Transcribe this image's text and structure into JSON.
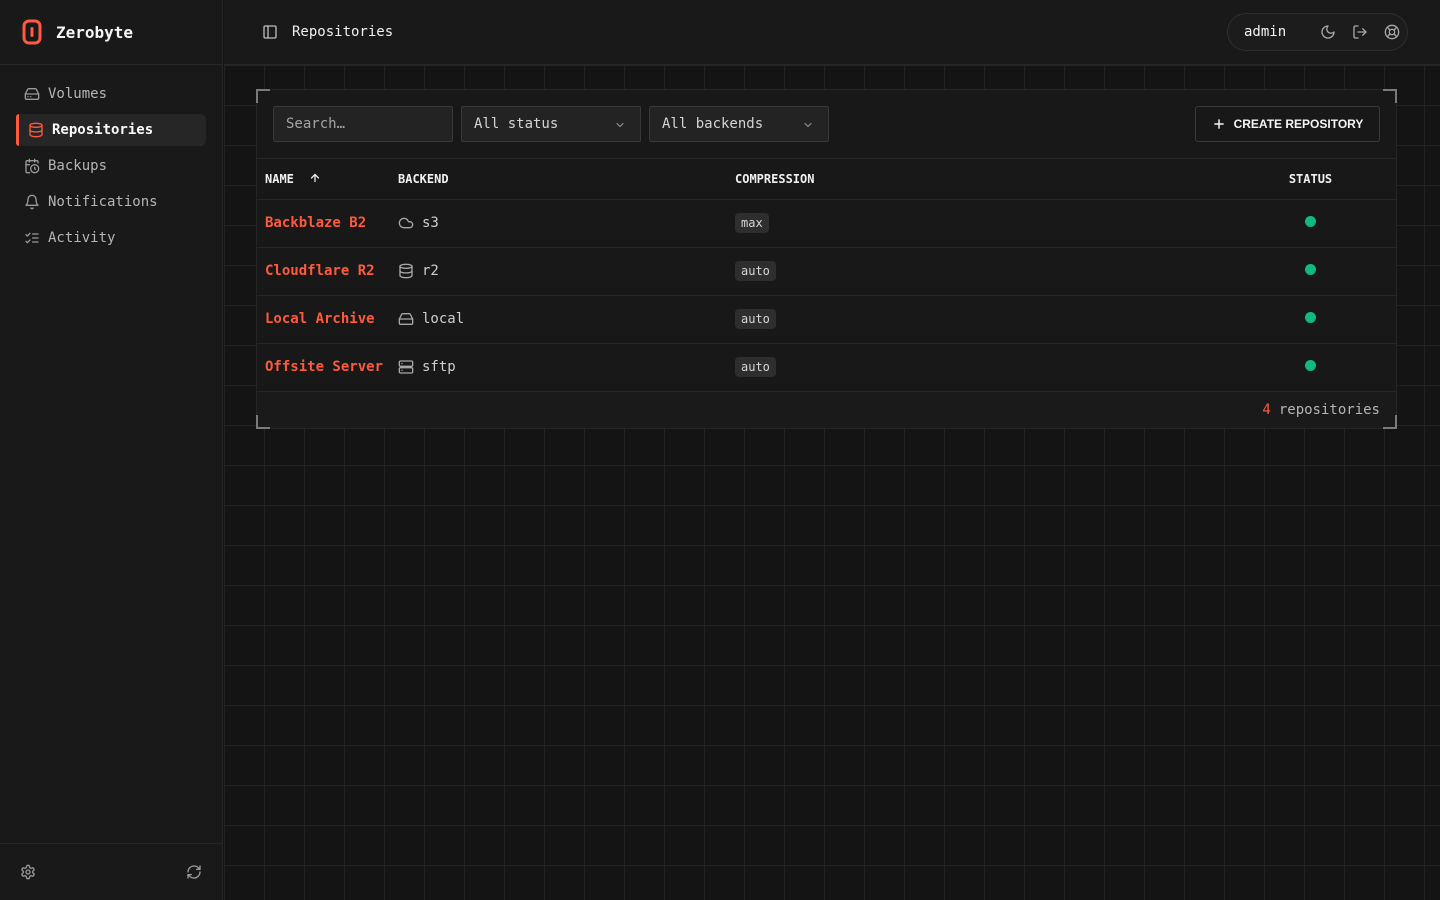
{
  "app": {
    "name": "Zerobyte"
  },
  "sidebar": {
    "items": [
      {
        "label": "Volumes",
        "icon": "hard-drive-icon",
        "active": false
      },
      {
        "label": "Repositories",
        "icon": "database-icon",
        "active": true
      },
      {
        "label": "Backups",
        "icon": "calendar-clock-icon",
        "active": false
      },
      {
        "label": "Notifications",
        "icon": "bell-icon",
        "active": false
      },
      {
        "label": "Activity",
        "icon": "list-checks-icon",
        "active": false
      }
    ],
    "footer_icons": [
      "settings-icon",
      "refresh-icon"
    ]
  },
  "header": {
    "title": "Repositories",
    "user": "admin",
    "icons": [
      "moon-icon",
      "logout-icon",
      "lifebuoy-icon"
    ]
  },
  "toolbar": {
    "search_placeholder": "Search…",
    "status_filter": "All status",
    "backend_filter": "All backends",
    "create_label": "CREATE REPOSITORY"
  },
  "table": {
    "columns": {
      "name": "NAME",
      "backend": "BACKEND",
      "compression": "COMPRESSION",
      "status": "STATUS"
    },
    "sort": {
      "column": "name",
      "direction": "asc"
    },
    "rows": [
      {
        "name": "Backblaze B2",
        "backend": "s3",
        "backend_icon": "cloud-icon",
        "compression": "max",
        "status": "healthy"
      },
      {
        "name": "Cloudflare R2",
        "backend": "r2",
        "backend_icon": "database-icon",
        "compression": "auto",
        "status": "healthy"
      },
      {
        "name": "Local Archive",
        "backend": "local",
        "backend_icon": "hard-drive-icon",
        "compression": "auto",
        "status": "healthy"
      },
      {
        "name": "Offsite Server",
        "backend": "sftp",
        "backend_icon": "server-icon",
        "compression": "auto",
        "status": "healthy"
      }
    ]
  },
  "footer": {
    "count": "4",
    "label": "repositories"
  },
  "colors": {
    "accent": "#ff5a3d",
    "status_ok": "#10b981",
    "background": "#141414"
  }
}
